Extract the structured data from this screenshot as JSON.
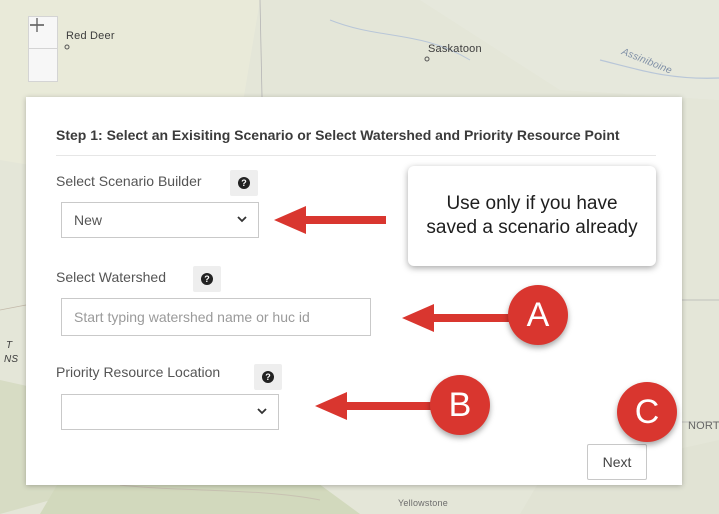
{
  "map": {
    "labels": {
      "red_deer": "Red Deer",
      "saskatoon": "Saskatoon",
      "assiniboine": "Assiniboine",
      "yellowstone": "Yellowstone",
      "nort": "NORT",
      "t": "T",
      "ns": "NS"
    },
    "zoom_in_icon": "plus-icon",
    "zoom_out_icon": "minus-icon"
  },
  "panel": {
    "title": "Step 1: Select an Exisiting Scenario or Select Watershed and Priority Resource Point",
    "scenario": {
      "label": "Select Scenario Builder",
      "value": "New"
    },
    "watershed": {
      "label": "Select Watershed",
      "placeholder": "Start typing watershed name or huc id"
    },
    "priority": {
      "label": "Priority Resource Location",
      "value": ""
    },
    "next_label": "Next",
    "help_icon": "question-circle-icon"
  },
  "annotations": {
    "callout": "Use only if you have saved a scenario already",
    "badge_a": "A",
    "badge_b": "B",
    "badge_c": "C",
    "accent": "#d9362f"
  }
}
